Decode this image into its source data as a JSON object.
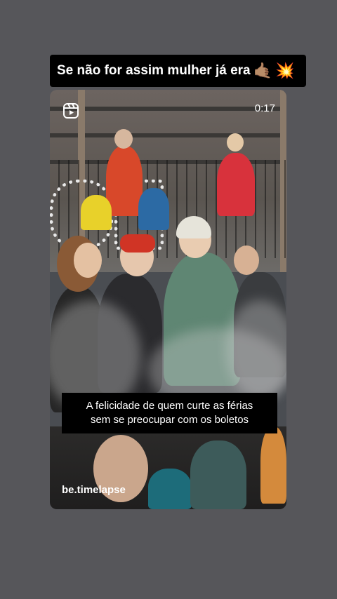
{
  "story": {
    "caption": "Se não for assim mulher já era",
    "caption_emojis": [
      "🤙🏽",
      "💥"
    ]
  },
  "reel": {
    "duration": "0:17",
    "subtitle_line1": "A felicidade de quem curte as férias",
    "subtitle_line2": "sem se preocupar com os boletos",
    "author_handle": "be.timelapse",
    "icon": "reels-icon"
  },
  "colors": {
    "background": "#56565a",
    "caption_bg": "#000000",
    "text": "#ffffff"
  }
}
